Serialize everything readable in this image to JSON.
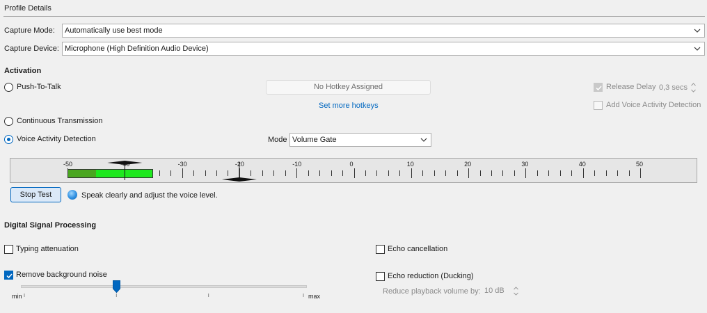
{
  "group": {
    "title": "Profile Details"
  },
  "capture": {
    "mode_label": "Capture Mode:",
    "mode_value": "Automatically use best mode",
    "device_label": "Capture Device:",
    "device_value": "Microphone (High Definition Audio Device)"
  },
  "activation": {
    "title": "Activation",
    "push_to_talk": "Push-To-Talk",
    "hotkey": "No Hotkey Assigned",
    "more_hotkeys": "Set more hotkeys",
    "release_delay": "Release Delay",
    "release_delay_value": "0,3 secs",
    "add_vad": "Add Voice Activity Detection",
    "continuous": "Continuous Transmission",
    "vad": "Voice Activity Detection",
    "mode_label": "Mode",
    "mode_value": "Volume Gate",
    "selected": "vad"
  },
  "meter": {
    "ticks": [
      "-50",
      "-40",
      "-30",
      "-20",
      "-10",
      "0",
      "10",
      "20",
      "30",
      "40",
      "50"
    ],
    "level_db": -35,
    "threshold_db": -40,
    "peak_db": -20
  },
  "test": {
    "button": "Stop Test",
    "hint": "Speak clearly and adjust the voice level."
  },
  "dsp": {
    "title": "Digital Signal Processing",
    "typing": "Typing attenuation",
    "noise": "Remove background noise",
    "noise_level": 0.33,
    "echo_cancel": "Echo cancellation",
    "echo_reduction": "Echo reduction (Ducking)",
    "reduce_label": "Reduce playback volume by:",
    "reduce_value": "10 dB",
    "min": "min",
    "max": "max"
  },
  "colors": {
    "accent": "#0067c0",
    "meter_dark": "#4aa620",
    "meter_light": "#1ee81e"
  }
}
